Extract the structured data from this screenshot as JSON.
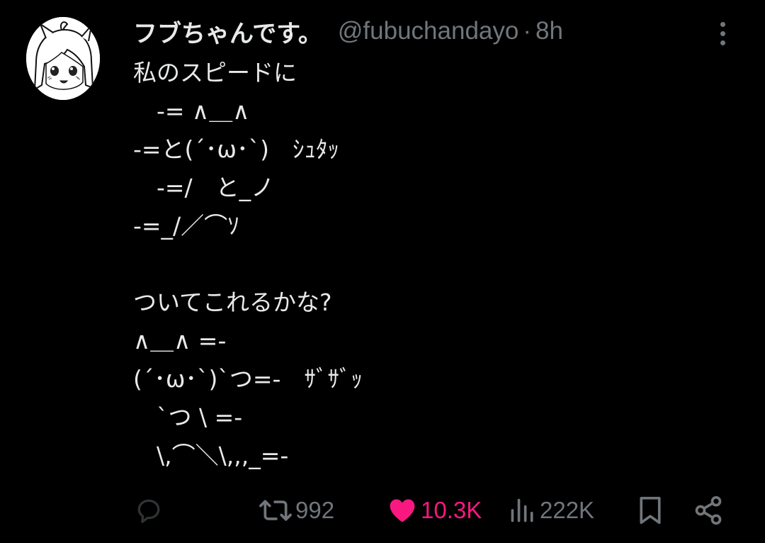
{
  "user": {
    "display_name": "フブちゃんです。",
    "handle": "@fubuchandayo",
    "separator": "·",
    "time": "8h"
  },
  "tweet": {
    "lines": [
      "私のスピードに",
      "　-= ∧＿∧",
      "-=と(´･ω･`)　ｼｭﾀｯ",
      "　-=/　と_ノ",
      "-=_/／⌒ｿ",
      "",
      "ついてこれるかな?",
      "∧＿∧ =-",
      "(´･ω･`)`つ=-　ｻﾞｻﾞｯ",
      "　`つ \\ =-",
      "　\\,⌒＼\\,,,_=-"
    ]
  },
  "actions": {
    "reply_count": "",
    "retweet_count": "992",
    "like_count": "10.3K",
    "views_count": "222K"
  },
  "icons": {
    "reply": "reply-icon",
    "retweet": "retweet-icon",
    "like": "heart-icon",
    "views": "views-icon",
    "bookmark": "bookmark-icon",
    "share": "share-icon",
    "more": "more-vertical-icon"
  },
  "colors": {
    "background": "#000000",
    "text": "#e7e9ea",
    "muted": "#71767b",
    "like": "#f91880"
  }
}
